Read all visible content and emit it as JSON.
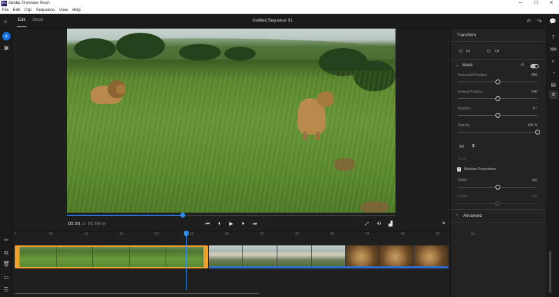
{
  "window": {
    "title": "Adobe Premiere Rush",
    "app_icon": "Ru",
    "controls": [
      "─",
      "☐",
      "✕"
    ]
  },
  "menu": [
    "File",
    "Edit",
    "Clip",
    "Sequence",
    "View",
    "Help"
  ],
  "header": {
    "tabs": [
      {
        "label": "Edit",
        "active": true
      },
      {
        "label": "Share",
        "active": false
      }
    ],
    "sequence_title": "Untitled Sequence 01"
  },
  "transport": {
    "current_time": "00:24",
    "current_frames": "12",
    "duration_time": "01:09",
    "duration_frames": "08",
    "playhead_fraction": 0.35
  },
  "panel": {
    "title": "Transform",
    "flip_labels": [
      "Fit",
      "Fill"
    ],
    "section_basic": "Basic",
    "section_advanced": "Advanced",
    "properties": [
      {
        "label": "Horizontal Position",
        "value": "960",
        "fraction": 0.5
      },
      {
        "label": "Vertical Position",
        "value": "540",
        "fraction": 0.5
      },
      {
        "label": "Rotation",
        "value": "0 °",
        "fraction": 0.5
      },
      {
        "label": "Opacity",
        "value": "100 %",
        "fraction": 1.0
      }
    ],
    "scale_label": "Scale",
    "maintain_proportions": "Maintain Proportions",
    "width": {
      "label": "Width",
      "value": "100",
      "fraction": 0.5
    },
    "height": {
      "label": "Height",
      "value": "100",
      "fraction": 0.5
    }
  },
  "timeline": {
    "ticks": [
      "4",
      "08",
      "12",
      "16",
      "20",
      "24",
      "28",
      "32",
      "36",
      "40",
      "44",
      "48",
      "52",
      "56"
    ]
  }
}
